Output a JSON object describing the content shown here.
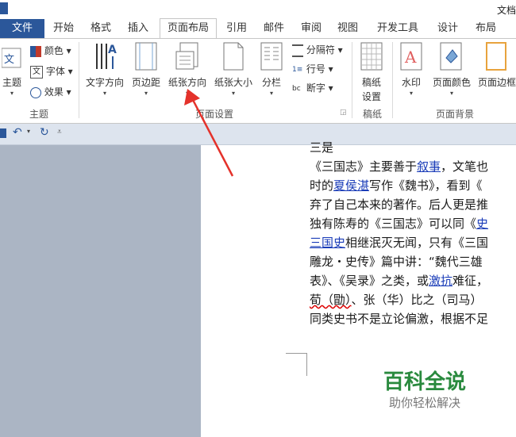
{
  "window": {
    "title": "文档"
  },
  "tabs": {
    "file": "文件",
    "items": [
      "开始",
      "格式",
      "插入",
      "页面布局",
      "引用",
      "邮件",
      "审阅",
      "视图",
      "开发工具",
      "设计",
      "布局"
    ],
    "active": "页面布局"
  },
  "ribbon": {
    "theme": {
      "main": "主题",
      "colors": "颜色",
      "fonts": "字体",
      "effects": "效果",
      "group": "主题"
    },
    "page_setup": {
      "text_direction": "文字方向",
      "margins": "页边距",
      "orientation": "纸张方向",
      "size": "纸张大小",
      "columns": "分栏",
      "breaks": "分隔符",
      "line_numbers": "行号",
      "hyphenation": "断字",
      "group": "页面设置"
    },
    "draft": {
      "label_line1": "稿纸",
      "label_line2": "设置",
      "group": "稿纸"
    },
    "page_background": {
      "watermark": "水印",
      "page_color": "页面颜色",
      "page_borders": "页面边框",
      "group": "页面背景"
    }
  },
  "document": {
    "lines": [
      [
        "三是"
      ],
      [
        "《三国志》主要善于",
        {
          "link": "叙事"
        },
        "，文笔也"
      ],
      [
        "时的",
        {
          "link": "夏侯湛"
        },
        "写作《魏书》，看到《"
      ],
      [
        "弃了自己本来的著作。后人更是推"
      ],
      [
        "独有陈寿的《三国志》可以同《",
        {
          "link": "史"
        }
      ],
      [
        {
          "link": "三国史"
        },
        "相继泯灭无闻，只有《三国"
      ],
      [
        "雕龙・史传》篇中讲：“魏代三雄"
      ],
      [
        "表》、《吴录》之类，或",
        {
          "link": "激抗"
        },
        "难征，"
      ],
      [
        {
          "wavy": "荀（勖）"
        },
        "、张（华）比之（司马）"
      ],
      [
        "同类史书不是立论偏激，根据不足"
      ]
    ]
  },
  "watermark": {
    "title": "百科全说",
    "subtitle": "助你轻松解决",
    "title_color": "#2a8a3e"
  },
  "colors": {
    "accent": "#2b579a",
    "arrow": "#e4322b",
    "doc_background": "#abb5c4"
  }
}
